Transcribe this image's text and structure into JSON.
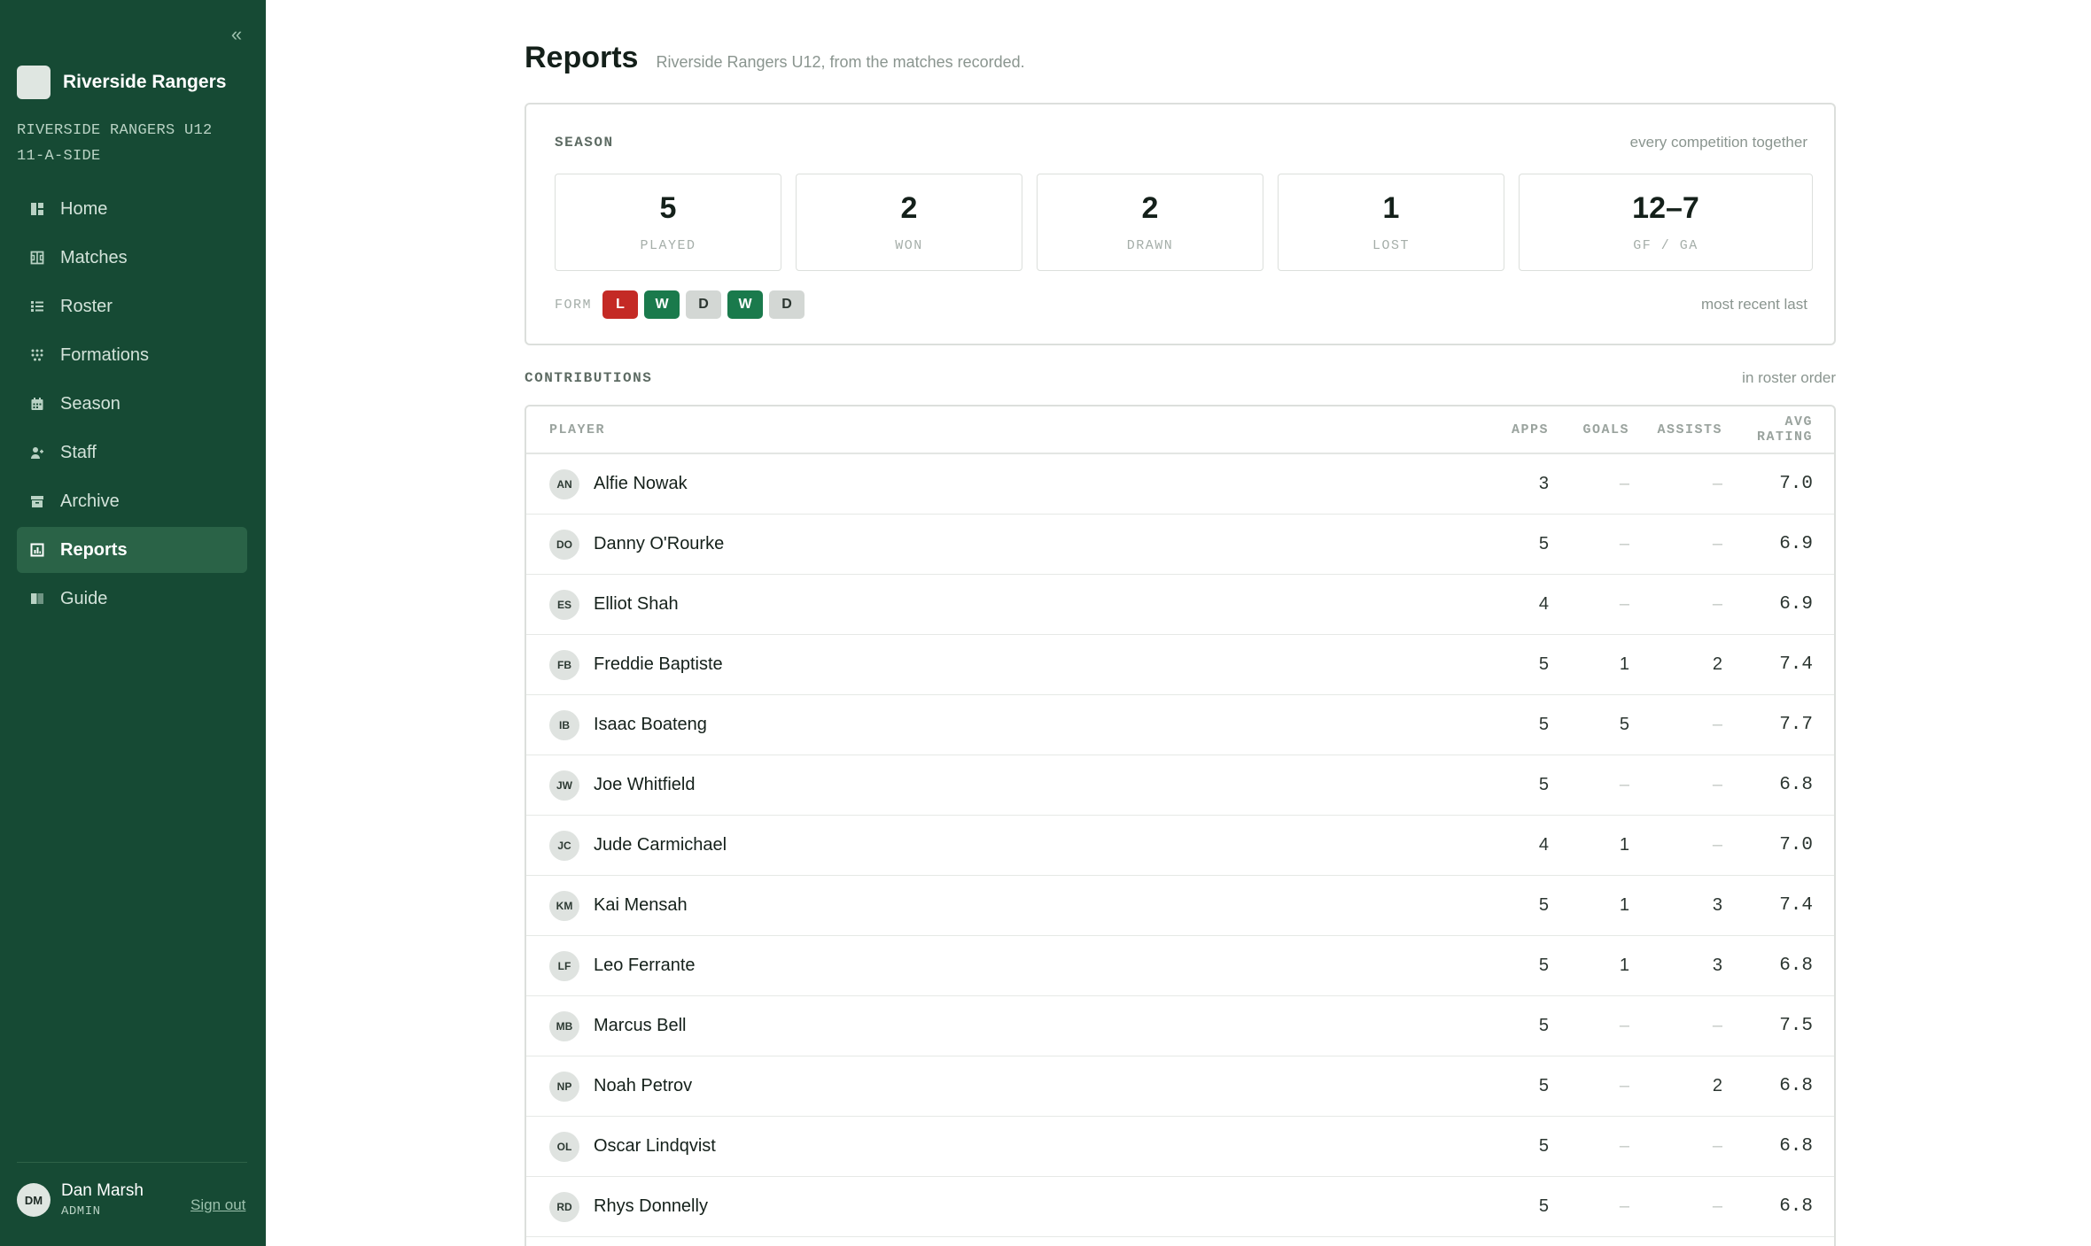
{
  "sidebar": {
    "collapse_glyph": "«",
    "brand_name": "Riverside Rangers",
    "team_line1": "RIVERSIDE RANGERS U12",
    "team_line2": "11-A-SIDE",
    "nav": [
      {
        "label": "Home",
        "icon": "dashboard-icon"
      },
      {
        "label": "Matches",
        "icon": "matches-icon"
      },
      {
        "label": "Roster",
        "icon": "list-icon"
      },
      {
        "label": "Formations",
        "icon": "formation-grid-icon"
      },
      {
        "label": "Season",
        "icon": "calendar-icon"
      },
      {
        "label": "Staff",
        "icon": "staff-icon"
      },
      {
        "label": "Archive",
        "icon": "archive-icon"
      },
      {
        "label": "Reports",
        "icon": "bar-chart-icon",
        "active": true
      },
      {
        "label": "Guide",
        "icon": "book-icon"
      }
    ],
    "user": {
      "initials": "DM",
      "name": "Dan Marsh",
      "role": "ADMIN",
      "signout": "Sign out"
    }
  },
  "header": {
    "title": "Reports",
    "subtitle": "Riverside Rangers U12, from the matches recorded."
  },
  "season": {
    "label": "SEASON",
    "note": "every competition together",
    "stats": [
      {
        "value": "5",
        "label": "PLAYED"
      },
      {
        "value": "2",
        "label": "WON"
      },
      {
        "value": "2",
        "label": "DRAWN"
      },
      {
        "value": "1",
        "label": "LOST"
      },
      {
        "value": "12–7",
        "label": "GF / GA"
      }
    ],
    "form_label": "FORM",
    "form": [
      "L",
      "W",
      "D",
      "W",
      "D"
    ],
    "form_note": "most recent last"
  },
  "contributions": {
    "label": "CONTRIBUTIONS",
    "note": "in roster order",
    "columns": {
      "player": "PLAYER",
      "apps": "APPS",
      "goals": "GOALS",
      "assists": "ASSISTS",
      "rating": "AVG RATING"
    },
    "rows": [
      {
        "initials": "AN",
        "name": "Alfie Nowak",
        "apps": "3",
        "goals": "–",
        "assists": "–",
        "rating": "7.0"
      },
      {
        "initials": "DO",
        "name": "Danny O'Rourke",
        "apps": "5",
        "goals": "–",
        "assists": "–",
        "rating": "6.9"
      },
      {
        "initials": "ES",
        "name": "Elliot Shah",
        "apps": "4",
        "goals": "–",
        "assists": "–",
        "rating": "6.9"
      },
      {
        "initials": "FB",
        "name": "Freddie Baptiste",
        "apps": "5",
        "goals": "1",
        "assists": "2",
        "rating": "7.4"
      },
      {
        "initials": "IB",
        "name": "Isaac Boateng",
        "apps": "5",
        "goals": "5",
        "assists": "–",
        "rating": "7.7"
      },
      {
        "initials": "JW",
        "name": "Joe Whitfield",
        "apps": "5",
        "goals": "–",
        "assists": "–",
        "rating": "6.8"
      },
      {
        "initials": "JC",
        "name": "Jude Carmichael",
        "apps": "4",
        "goals": "1",
        "assists": "–",
        "rating": "7.0"
      },
      {
        "initials": "KM",
        "name": "Kai Mensah",
        "apps": "5",
        "goals": "1",
        "assists": "3",
        "rating": "7.4"
      },
      {
        "initials": "LF",
        "name": "Leo Ferrante",
        "apps": "5",
        "goals": "1",
        "assists": "3",
        "rating": "6.8"
      },
      {
        "initials": "MB",
        "name": "Marcus Bell",
        "apps": "5",
        "goals": "–",
        "assists": "–",
        "rating": "7.5"
      },
      {
        "initials": "NP",
        "name": "Noah Petrov",
        "apps": "5",
        "goals": "–",
        "assists": "2",
        "rating": "6.8"
      },
      {
        "initials": "OL",
        "name": "Oscar Lindqvist",
        "apps": "5",
        "goals": "–",
        "assists": "–",
        "rating": "6.8"
      },
      {
        "initials": "RD",
        "name": "Rhys Donnelly",
        "apps": "5",
        "goals": "–",
        "assists": "–",
        "rating": "6.8"
      }
    ]
  }
}
